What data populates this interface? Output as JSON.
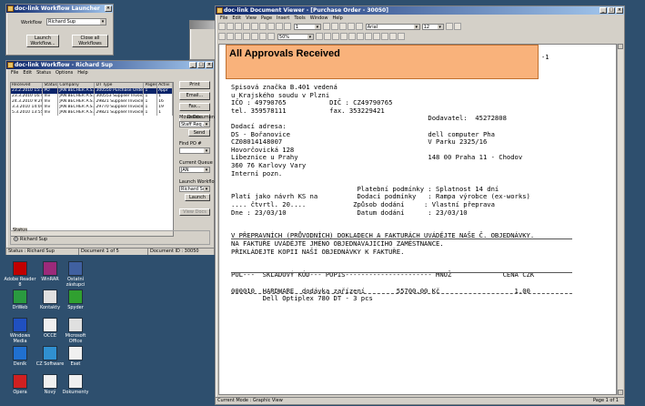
{
  "launcher": {
    "title": "doc-link Workflow Launcher",
    "workflow_label": "Workflow",
    "workflow_value": "Richard Sup",
    "launch_btn": "Launch Workflow...",
    "close_btn": "Close all Workflows"
  },
  "queue": {
    "title": "doc-link Workflow - Richard Sup",
    "menu": [
      "File",
      "Edit",
      "Status",
      "Options",
      "Help"
    ],
    "columns": [
      "Received",
      "Status",
      "Company",
      "DT Type",
      "Pages",
      "Activi"
    ],
    "rows": [
      [
        "23.2.2010 15:14:17",
        "PO",
        "JAN BECHER A.S.",
        "300550 Purchase Order",
        "1",
        "Appr"
      ],
      [
        "23.3.2010 16:45:53",
        "Inv",
        "JAN BECHER A.S.",
        "300553 Supplier Invoice",
        "1",
        "1"
      ],
      [
        "24.3.2010 9:29:35",
        "Inv",
        "JAN BECHER A.S.",
        "29821 Supplier Invoice",
        "1",
        "16"
      ],
      [
        "3.3.2010 14:04:06",
        "Inv",
        "JAN BECHER A.S.",
        "29770 Supplier Invoice",
        "1",
        "19"
      ],
      [
        "5.3.2010 13:55:45",
        "Inv",
        "JAN BECHER A.S.",
        "29821 Supplier Invoice",
        "1",
        "1"
      ]
    ],
    "btn_print": "Print",
    "btn_email": "Email...",
    "btn_fax": "Fax...",
    "btn_delete": "Delete",
    "move_label": "Move Document",
    "move_value": "Staff Req Ap",
    "btn_send": "Send",
    "find_label": "Find PO #",
    "current_label": "Current Queue",
    "current_value": "JAN",
    "launch_label": "Launch Workflow",
    "launch_value": "Richard Sup",
    "btn_launch": "Launch",
    "btn_view": "View Docs",
    "status_label": "Status",
    "radio_label": "Richard Sup",
    "statusbar": [
      "Status : Richard Sup",
      "Document 1 of 5",
      "Document ID : 30050"
    ]
  },
  "viewer": {
    "title": "doc-link Document Viewer - [Purchase Order - 30050]",
    "menu": [
      "File",
      "Edit",
      "View",
      "Page",
      "Insert",
      "Tools",
      "Window",
      "Help"
    ],
    "page_field": "1",
    "zoom": "50%",
    "font": "Arial",
    "fontsize": "12",
    "banner": "All Approvals Received",
    "page_mark": "-1",
    "doc_lines": [
      "Spisová značka B.401 vedená",
      "u Krajského soudu v Plzni",
      "IČO : 49790765           DIČ : CZ49790765",
      "tel. 359578111           fax. 353229421",
      "                                                  Dodavatel:  45272808",
      "Dodací adresa:",
      "DS - Bořanovice                                   dell computer Pha",
      "CZ08014148007                                     V Parku 2325/16",
      "Hovorčovická 128",
      "Libeznice u Prahy                                 148 00 Praha 11 - Chodov",
      "360 76 Karlovy Vary",
      "Interní pozn.",
      "",
      "                                Platební podmínky : Splatnost 14 dní",
      "Platí jako návrh KS na          Dodací podmínky   : Rampa výrobce (ex-works)",
      ".... čtvrtl. 20....            Způsob dodání     : Vlastní přeprava",
      "Dne : 23/03/10                  Datum dodání      : 23/03/10",
      "",
      "",
      "V PŘEPRAVNÍCH (PRŮVODNÍCH) DOKLADECH A FAKTURÁCH UVÁDĚJTE NAŠE Č. OBJEDNÁVKY.",
      "NA FAKTUŘE UVÁDĚJTE JMÉNO OBJEDNÁVAJÍCÍHO ZAMĚSTNANCE.",
      "PŘIKLÁDEJTE KOPII NAŠÍ OBJEDNÁVKY K FAKTUŘE.",
      "",
      "",
      "POL---  SKLADOVÝ KÓD--- POPIS---------------------- MNOŽ             CENA CZK",
      "",
      "000010  HARDWARE  dodávka zařízení        55700,00 Kč                   1,00",
      "        Dell Optiplex 780 DT - 3 pcs"
    ],
    "status_left": "Current Mode : Graphic View",
    "status_right": "Page 1 of 1"
  },
  "desktop_icons": [
    {
      "label": "Adobe Reader 8",
      "color": "#c00000"
    },
    {
      "label": "WinRAR",
      "color": "#9b2a7a"
    },
    {
      "label": "Ostatní zástupci",
      "color": "#4060a0"
    },
    {
      "label": "DrWeb",
      "color": "#2a9a40"
    },
    {
      "label": "Kontakty",
      "color": "#e0e0e0"
    },
    {
      "label": "Spyder",
      "color": "#30a030"
    },
    {
      "label": "Windows Media",
      "color": "#2050c0"
    },
    {
      "label": "OCCE",
      "color": "#f0f0f0"
    },
    {
      "label": "Microsoft Office",
      "color": "#e0e0e0"
    },
    {
      "label": "Deník",
      "color": "#2070d0"
    },
    {
      "label": "CZ Software",
      "color": "#3090d0"
    },
    {
      "label": "Eset",
      "color": "#f0f0f0"
    },
    {
      "label": "Opera",
      "color": "#d02020"
    },
    {
      "label": "Nový",
      "color": "#f0f0f0"
    },
    {
      "label": "Dokumenty",
      "color": "#f0f0f0"
    }
  ]
}
